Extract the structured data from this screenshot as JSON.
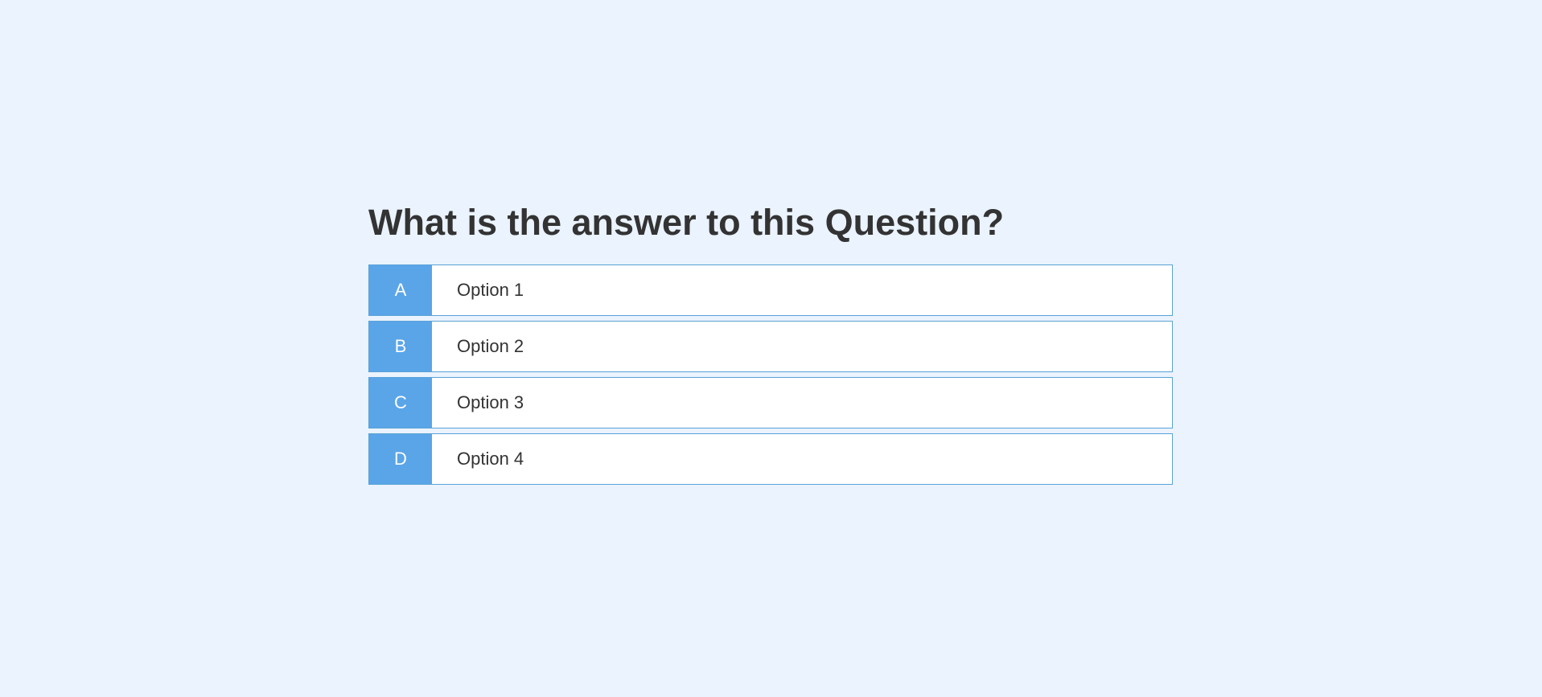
{
  "quiz": {
    "question": "What is the answer to this Question?",
    "options": [
      {
        "letter": "A",
        "label": "Option 1"
      },
      {
        "letter": "B",
        "label": "Option 2"
      },
      {
        "letter": "C",
        "label": "Option 3"
      },
      {
        "letter": "D",
        "label": "Option 4"
      }
    ]
  },
  "colors": {
    "background": "#eaf3fe",
    "accent": "#5aa5e8",
    "border": "#5aa2d6",
    "text": "#333333"
  }
}
